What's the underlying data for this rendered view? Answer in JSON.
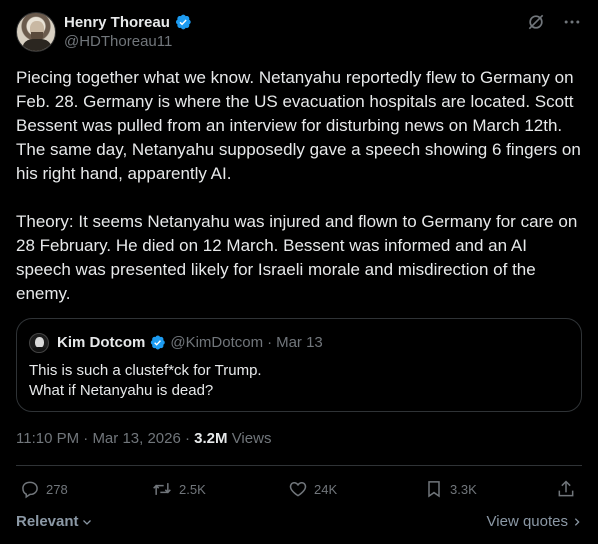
{
  "author": {
    "display_name": "Henry Thoreau",
    "handle": "@HDThoreau11",
    "verified": true
  },
  "header_icons": [
    "grok-icon",
    "more-icon"
  ],
  "tweet": {
    "paragraphs": [
      "Piecing together what we know.  Netanyahu reportedly flew to Germany on Feb. 28.  Germany is where the US evacuation hospitals are located.  Scott Bessent was pulled from an interview for disturbing news on March 12th.  The same day, Netanyahu supposedly gave a speech showing 6 fingers on his right hand, apparently AI.",
      "Theory: It seems Netanyahu was injured and flown to Germany for care on  28 February.  He died on 12 March. Bessent was informed and an AI speech was presented likely for Israeli morale and misdirection of the enemy."
    ]
  },
  "quote": {
    "display_name": "Kim Dotcom",
    "handle": "@KimDotcom",
    "separator": "·",
    "date": "Mar 13",
    "lines": [
      "This is such a clustef*ck for Trump.",
      "What if Netanyahu is dead?"
    ]
  },
  "meta": {
    "time": "11:10 PM",
    "separator": "·",
    "date": "Mar 13, 2026",
    "views_count": "3.2M",
    "views_label": "Views"
  },
  "actions": {
    "replies": "278",
    "reposts": "2.5K",
    "likes": "24K",
    "bookmarks": "3.3K"
  },
  "footer": {
    "sort_label": "Relevant",
    "view_quotes_label": "View quotes"
  },
  "colors": {
    "background": "#000000",
    "text": "#e7e9ea",
    "muted": "#71767b",
    "verified_blue": "#1d9bf0",
    "border": "#2f3336"
  }
}
